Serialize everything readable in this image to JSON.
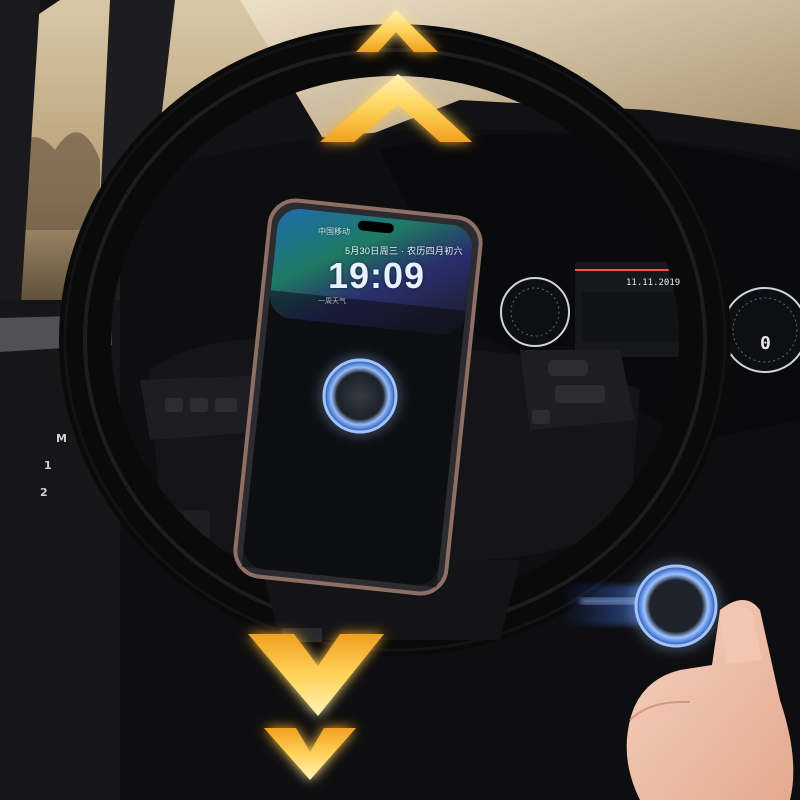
{
  "phone": {
    "status_text": "中国移动",
    "date_text": "5月30日周三 · 农历四月初六",
    "time": "19:09",
    "note_text": "一周天气"
  },
  "dashboard": {
    "date_display": "11.11.2019",
    "gear_display": "0"
  },
  "door_controls": {
    "memory_key": "M",
    "seat_key_1": "1",
    "seat_key_2": "2"
  },
  "colors": {
    "arrow_glow": "#ffd35a",
    "magnet_ring": "#6aa7ff",
    "wheel": "#111111",
    "sky": "#c9b18c"
  },
  "icons": {
    "up_arrows": "double-chevron-up-icon",
    "down_arrows": "double-chevron-down-icon",
    "magnet_disc": "magnetic-mount-disc"
  }
}
